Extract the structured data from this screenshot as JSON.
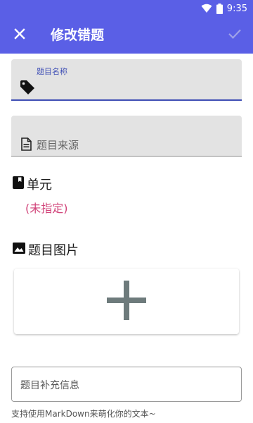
{
  "status_bar": {
    "time": "9:35",
    "icons": [
      "wifi-icon",
      "battery-icon"
    ]
  },
  "app_bar": {
    "title": "修改错题",
    "close_icon": "close-icon",
    "confirm_icon": "check-icon"
  },
  "form": {
    "name_label": "题目名称",
    "name_value": "",
    "source_placeholder": "题目来源",
    "unit_heading": "单元",
    "unit_value": "(未指定)",
    "image_heading": "题目图片",
    "add_icon": "plus-icon",
    "extra_placeholder": "题目补充信息",
    "hint": "支持使用MarkDown来萌化你的文本~"
  },
  "colors": {
    "primary": "#5a5fe6",
    "accent_text": "#3f4fb5",
    "unit_value": "#d1447a"
  }
}
